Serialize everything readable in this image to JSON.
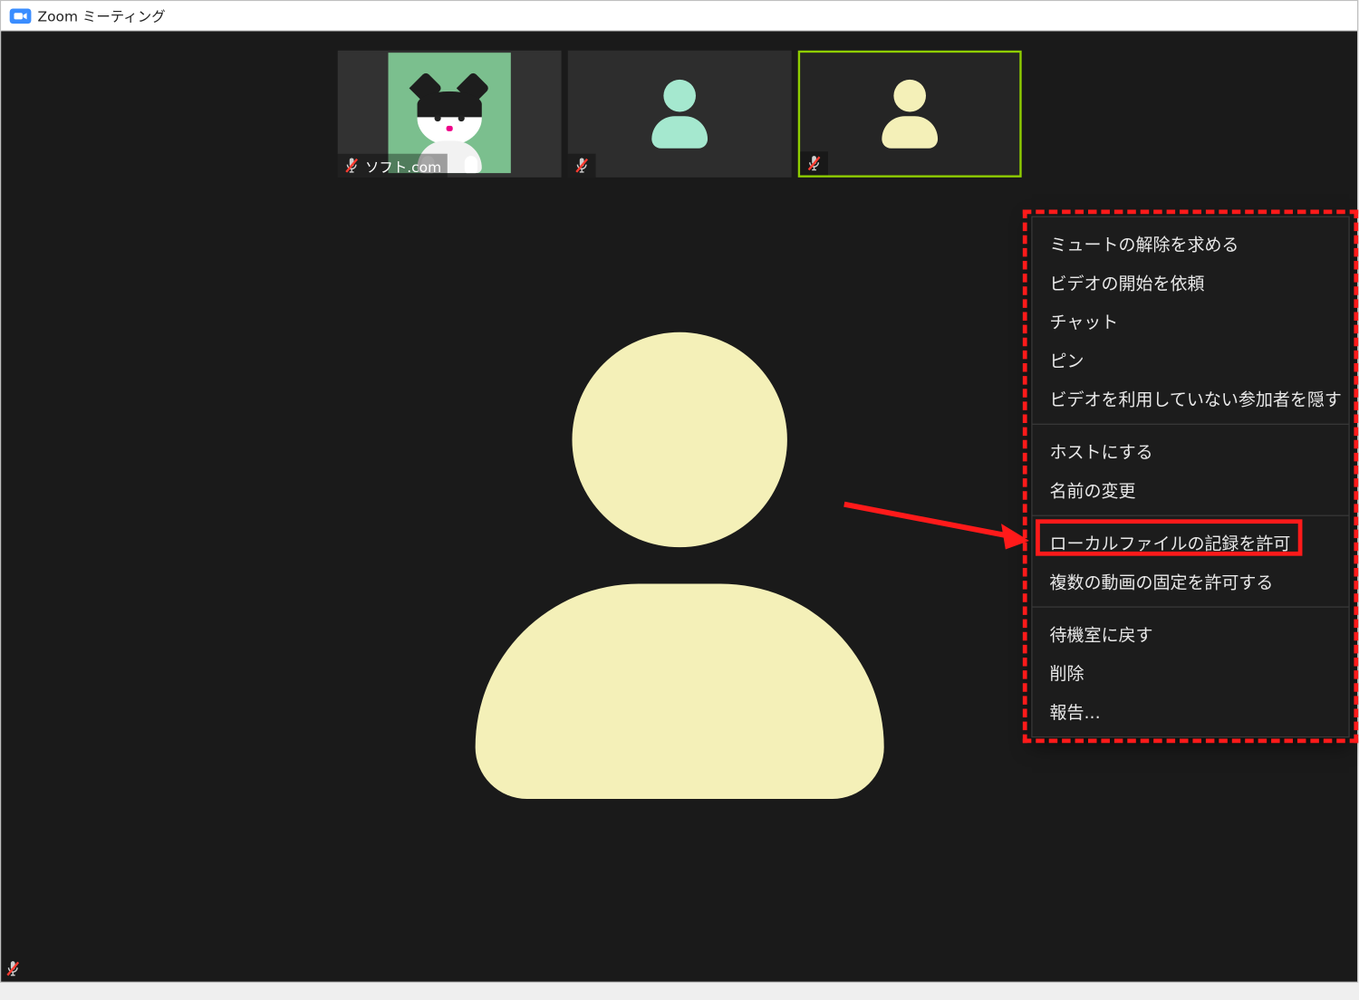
{
  "window": {
    "title": "Zoom ミーティング"
  },
  "tiles": {
    "t1_label": "ソフト.com"
  },
  "contextMenu": {
    "group1": {
      "askUnmute": "ミュートの解除を求める",
      "askVideo": "ビデオの開始を依頼",
      "chat": "チャット",
      "pin": "ピン",
      "hideNonVideo": "ビデオを利用していない参加者を隠す"
    },
    "group2": {
      "makeHost": "ホストにする",
      "rename": "名前の変更"
    },
    "group3": {
      "allowLocalRecord": "ローカルファイルの記録を許可",
      "allowMultiPin": "複数の動画の固定を許可する"
    },
    "group4": {
      "backToWaiting": "待機室に戻す",
      "remove": "削除",
      "report": "報告..."
    }
  }
}
